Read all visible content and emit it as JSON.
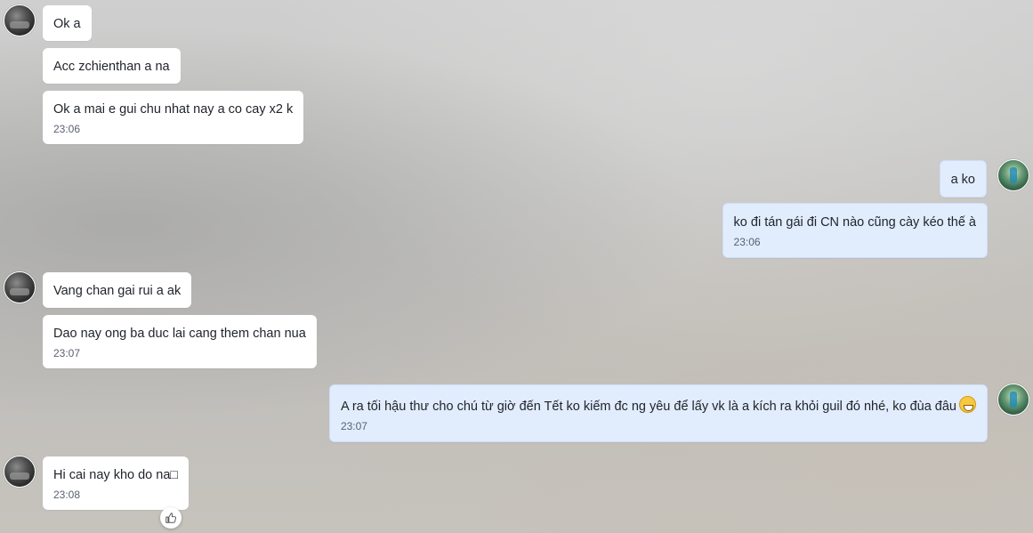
{
  "messages": [
    {
      "text": "Ok a"
    },
    {
      "text": "Acc zchienthan a na"
    },
    {
      "text": "Ok a mai e gui chu nhat nay a co cay x2 k",
      "time": "23:06"
    },
    {
      "text": "a ko"
    },
    {
      "text": "ko đi tán gái đi CN nào cũng cày kéo thế à",
      "time": "23:06"
    },
    {
      "text": "Vang chan gai rui a ak"
    },
    {
      "text": "Dao nay ong ba duc lai cang them chan nua",
      "time": "23:07"
    },
    {
      "text": "A ra tối hậu thư cho chú từ giờ đến Tết ko kiếm đc ng yêu để lấy vk là a kích ra khỏi guil đó nhé, ko đùa đâu",
      "emoji": "grinning-emoji",
      "time": "23:07"
    },
    {
      "text": "Hi cai nay kho do na□",
      "time": "23:08"
    }
  ],
  "icons": {
    "reaction": "thumbs-up-icon",
    "emoji": "grinning-face-emoji"
  },
  "colors": {
    "incoming_bubble": "#ffffff",
    "outgoing_bubble": "#e1ecfd",
    "text": "#1f2329",
    "time": "#5a6170"
  }
}
